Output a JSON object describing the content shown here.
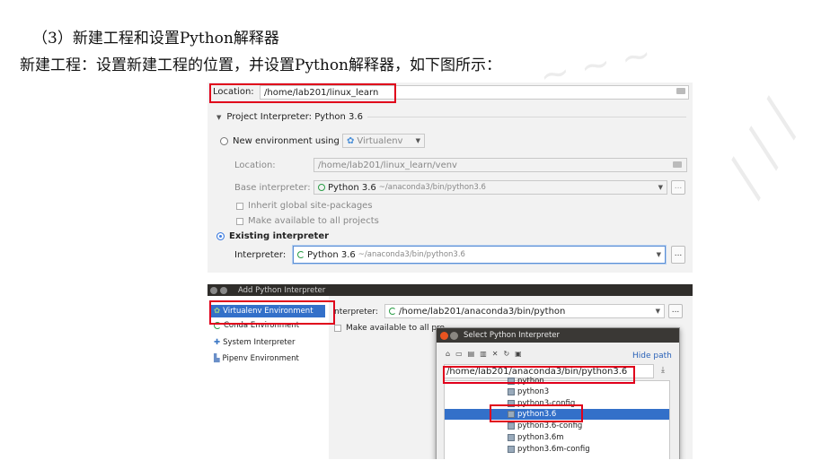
{
  "doc": {
    "line1": "（3）新建工程和设置Python解释器",
    "line2": "新建工程：设置新建工程的位置，并设置Python解释器，如下图所示："
  },
  "project_panel": {
    "location_label": "Location:",
    "location_value": "/home/lab201/linux_learn",
    "section_title": "Project Interpreter: Python 3.6",
    "new_env_label": "New environment using",
    "new_env_tool": "Virtualenv",
    "venv_location_label": "Location:",
    "venv_location_value": "/home/lab201/linux_learn/venv",
    "base_interp_label": "Base interpreter:",
    "base_interp_name": "Python 3.6",
    "base_interp_path": "~/anaconda3/bin/python3.6",
    "inherit_label": "Inherit global site-packages",
    "make_available_label": "Make available to all projects",
    "existing_label": "Existing interpreter",
    "interpreter_label": "Interpreter:",
    "interpreter_name": "Python 3.6",
    "interpreter_path": "~/anaconda3/bin/python3.6",
    "more_btn": "..."
  },
  "add_interp": {
    "window_title": "Add Python Interpreter",
    "sidebar": [
      "Virtualenv Environment",
      "Conda Environment",
      "System Interpreter",
      "Pipenv Environment"
    ],
    "interpreter_label": "nterpreter:",
    "interpreter_value": "/home/lab201/anaconda3/bin/python",
    "make_available": "Make available to all pro",
    "more_btn": "..."
  },
  "select_dialog": {
    "title": "Select Python Interpreter",
    "hide_path": "Hide path",
    "path_value": "/home/lab201/anaconda3/bin/python3.6",
    "files": [
      "python",
      "python3",
      "python3-config",
      "python3.6",
      "python3.6-config",
      "python3.6m",
      "python3.6m-config"
    ],
    "selected": "python3.6"
  }
}
